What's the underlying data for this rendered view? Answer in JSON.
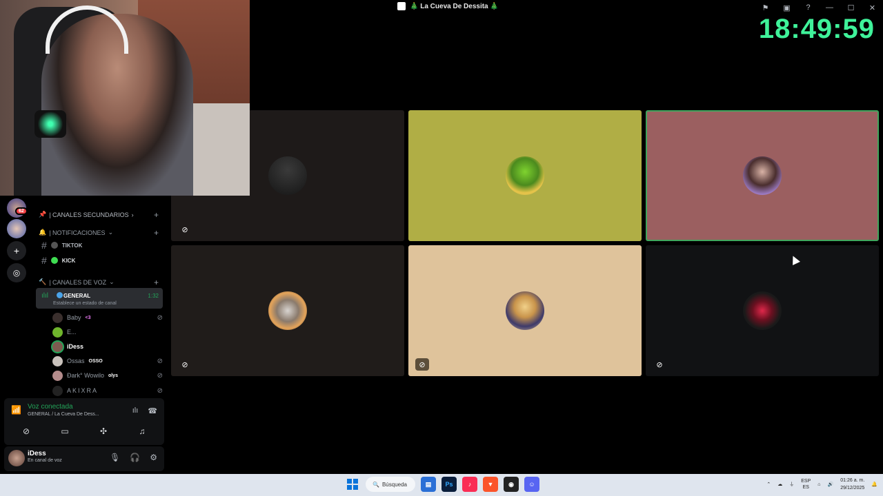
{
  "window": {
    "title": "🎄 La Cueva De Dessita 🎄"
  },
  "clock": "18:49:59",
  "servers": {
    "badge": "62"
  },
  "channels": {
    "cat_secondary": "| CANALES SECUNDARIOS",
    "cat_notifications": "| NOTIFICACIONES",
    "tiktok": "TIKTOK",
    "kick": "KICK",
    "cat_voice": "| CANALES DE VOZ",
    "voice_channel": {
      "name": "GENERAL",
      "time": "1:32",
      "status": "Establece un estado de canal"
    },
    "members": [
      {
        "name": "Baby",
        "tag": "<3"
      },
      {
        "name": "E...",
        "tag": ""
      },
      {
        "name": "iDess",
        "tag": ""
      },
      {
        "name": "Ossas",
        "tag": "OSSO"
      },
      {
        "name": "Ðark° Wowilo",
        "tag": "olys"
      },
      {
        "name": "AKIXRA",
        "tag": ""
      }
    ]
  },
  "voice_panel": {
    "title": "Voz conectada",
    "subtitle": "GENERAL / La Cueva De Dess..."
  },
  "user_panel": {
    "name": "iDess",
    "status": "En canal de voz"
  },
  "taskbar": {
    "search": "Búsqueda",
    "lang": "ESP",
    "region": "ES",
    "time": "01:26 a. m.",
    "date": "29/12/2025",
    "apps": [
      "Ps"
    ]
  },
  "colors": {
    "accent_green": "#23a559",
    "clock_green": "#3ff29a",
    "speaking_border": "#3fa55d"
  }
}
